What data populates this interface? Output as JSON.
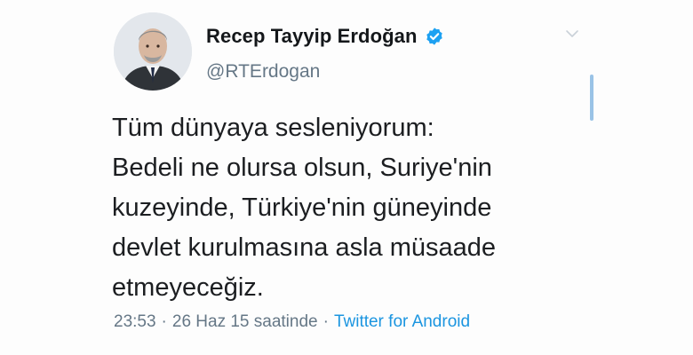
{
  "tweet": {
    "display_name": "Recep Tayyip Erdoğan",
    "handle": "@RTErdogan",
    "verified": true,
    "text_lines": [
      "Tüm dünyaya sesleniyorum:",
      "Bedeli ne olursa olsun, Suriye'nin",
      "kuzeyinde, Türkiye'nin güneyinde",
      "devlet kurulmasına asla müsaade",
      "etmeyeceğiz."
    ],
    "time": "23:53",
    "date": "26 Haz 15 saatinde",
    "separator": "·",
    "source": "Twitter for Android"
  },
  "icons": {
    "verified": "verified-badge-icon",
    "menu": "chevron-down-icon"
  },
  "colors": {
    "name": "#14171a",
    "secondary": "#657786",
    "link": "#1b95e0",
    "verified": "#1da1f2",
    "text": "#1c1e21"
  }
}
